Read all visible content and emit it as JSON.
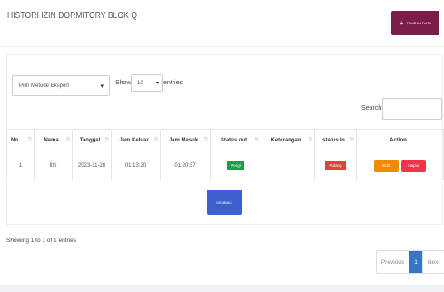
{
  "header": {
    "title": "HISTORI IZIN DORMITORY BLOK Q",
    "add_button": "TAMBAH DATA"
  },
  "controls": {
    "export_select": "Pilih Metode Eksport",
    "show_label": "Show",
    "show_value": "10",
    "entries_label": "entries",
    "search_label": "Search:"
  },
  "table": {
    "headers": [
      "No",
      "Nama",
      "Tanggal",
      "Jam Keluar",
      "Jam Masuk",
      "Status out",
      "Keterangan",
      "status in",
      "Action"
    ],
    "rows": [
      {
        "no": "1",
        "nama": "fitri",
        "tanggal": "2023-11-28",
        "jam_keluar": "01:13:20",
        "jam_masuk": "01:20:37",
        "status_out": "Pergi",
        "keterangan": "",
        "status_in": "Pulang",
        "edit": "Edit",
        "hapus": "Hapus"
      }
    ]
  },
  "back_button": "KEMBALI",
  "footer": {
    "info": "Showing 1 to 1 of 1 entries",
    "prev": "Previous",
    "page": "1",
    "next": "Next"
  },
  "colors": {
    "primary": "#7b1c4b",
    "success": "#1e9e4a",
    "danger": "#e0413c",
    "warning": "#f28a00",
    "info": "#3e5fcf",
    "pager_active": "#3a75c4"
  }
}
